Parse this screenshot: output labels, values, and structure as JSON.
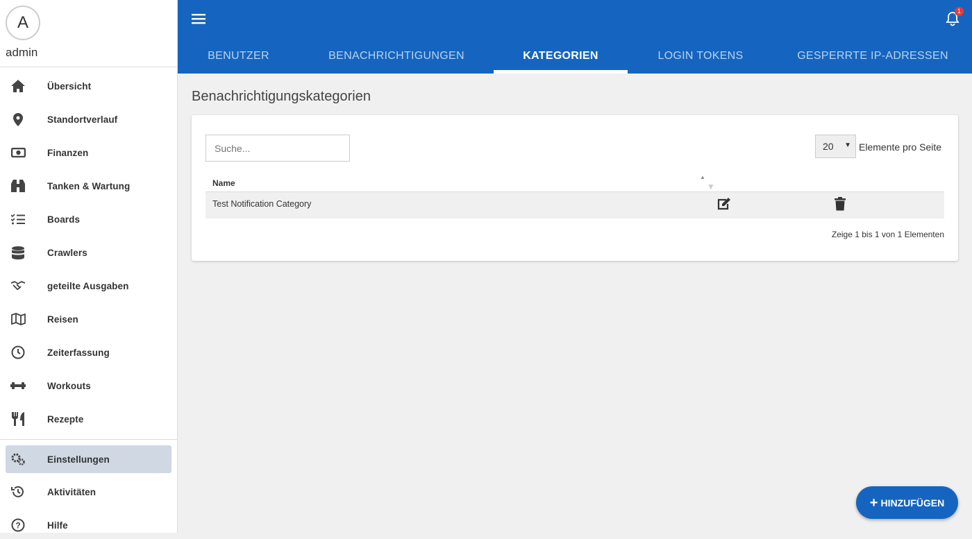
{
  "user": {
    "initial": "A",
    "name": "admin"
  },
  "sidebar": {
    "items": [
      {
        "label": "Übersicht",
        "icon": "home-icon"
      },
      {
        "label": "Standortverlauf",
        "icon": "map-marker-icon"
      },
      {
        "label": "Finanzen",
        "icon": "money-bill-icon"
      },
      {
        "label": "Tanken & Wartung",
        "icon": "binoculars-icon"
      },
      {
        "label": "Boards",
        "icon": "tasks-icon"
      },
      {
        "label": "Crawlers",
        "icon": "database-icon"
      },
      {
        "label": "geteilte Ausgaben",
        "icon": "handshake-icon"
      },
      {
        "label": "Reisen",
        "icon": "map-icon"
      },
      {
        "label": "Zeiterfassung",
        "icon": "clock-icon"
      },
      {
        "label": "Workouts",
        "icon": "dumbbell-icon"
      },
      {
        "label": "Rezepte",
        "icon": "utensils-icon"
      }
    ],
    "bottom": [
      {
        "label": "Einstellungen",
        "icon": "cogs-icon"
      },
      {
        "label": "Aktivitäten",
        "icon": "history-icon"
      },
      {
        "label": "Hilfe",
        "icon": "question-circle-icon"
      }
    ]
  },
  "header": {
    "notification_count": "1",
    "tabs": [
      "BENUTZER",
      "BENACHRICHTIGUNGEN",
      "KATEGORIEN",
      "LOGIN TOKENS",
      "GESPERRTE IP-ADRESSEN"
    ],
    "active_tab": 2
  },
  "page": {
    "title": "Benachrichtigungskategorien",
    "search_placeholder": "Suche...",
    "page_size": "20",
    "page_size_label": "Elemente pro Seite",
    "columns": [
      "Name"
    ],
    "rows": [
      {
        "name": "Test Notification Category"
      }
    ],
    "info": "Zeige 1 bis 1 von 1 Elementen",
    "add_label": "HINZUFÜGEN"
  },
  "colors": {
    "primary": "#1565c0",
    "active_item": "#cfd8e3",
    "badge": "#e53935"
  }
}
